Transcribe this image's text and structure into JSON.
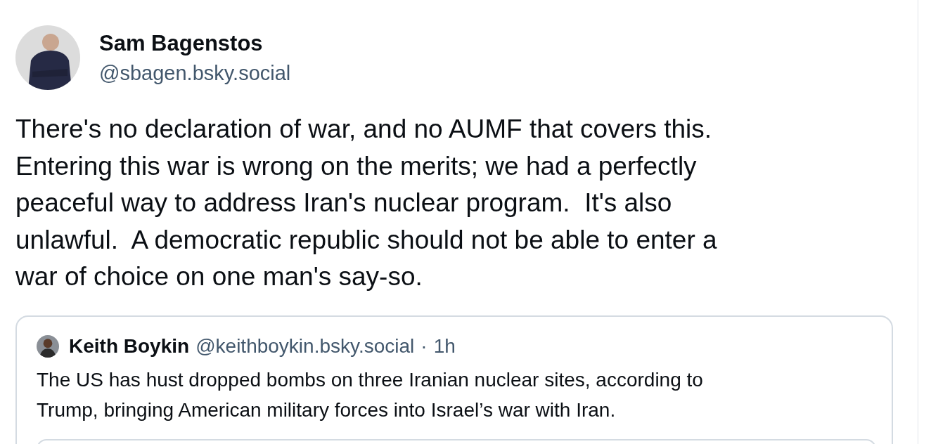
{
  "post": {
    "author": {
      "display_name": "Sam Bagenstos",
      "handle": "@sbagen.bsky.social"
    },
    "text": "There's no declaration of war, and no AUMF that covers this.\nEntering this war is wrong on the merits; we had a perfectly\npeaceful way to address Iran's nuclear program.  It's also\nunlawful.  A democratic republic should not be able to enter a\nwar of choice on one man's say-so.",
    "quote": {
      "author": {
        "display_name": "Keith Boykin",
        "handle": "@keithboykin.bsky.social"
      },
      "separator": "·",
      "time": "1h",
      "text": "The US has hust dropped bombs on three Iranian nuclear sites, according to\nTrump, bringing American military forces into Israel’s war with Iran.",
      "embed": {
        "kind": "card"
      }
    }
  }
}
